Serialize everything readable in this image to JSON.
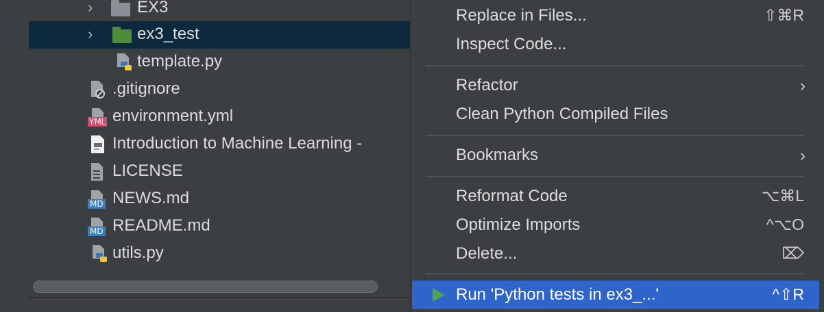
{
  "project_tree": {
    "items": [
      {
        "label": "EX3",
        "type": "folder"
      },
      {
        "label": "ex3_test",
        "type": "folder-test",
        "selected": true
      },
      {
        "label": "template.py",
        "type": "python"
      },
      {
        "label": ".gitignore",
        "type": "ignore"
      },
      {
        "label": "environment.yml",
        "type": "yml",
        "badge": "YML"
      },
      {
        "label": "Introduction to Machine Learning -",
        "type": "pdf"
      },
      {
        "label": "LICENSE",
        "type": "text"
      },
      {
        "label": "NEWS.md",
        "type": "markdown",
        "badge": "MD"
      },
      {
        "label": "README.md",
        "type": "markdown",
        "badge": "MD"
      },
      {
        "label": "utils.py",
        "type": "python"
      }
    ]
  },
  "context_menu": {
    "items": [
      {
        "label": "Replace in Files...",
        "shortcut": "⇧⌘R"
      },
      {
        "label": "Inspect Code..."
      },
      {
        "label": "Refactor",
        "submenu": true
      },
      {
        "label": "Clean Python Compiled Files"
      },
      {
        "label": "Bookmarks",
        "submenu": true
      },
      {
        "label": "Reformat Code",
        "shortcut": "⌥⌘L"
      },
      {
        "label": "Optimize Imports",
        "shortcut": "^⌥O"
      },
      {
        "label": "Delete...",
        "shortcut": "⌦"
      },
      {
        "label": "Run 'Python tests in ex3_...'",
        "shortcut": "^⇧R",
        "active": true
      }
    ]
  },
  "colors": {
    "selection": "#0d293e",
    "menu_highlight": "#2f65ca",
    "run_green": "#4ea64d",
    "test_folder_green": "#4f8c3a"
  },
  "icons": {
    "chevron": "chevron-right-icon",
    "submenu": "submenu-arrow-icon",
    "run": "run-triangle-icon"
  }
}
